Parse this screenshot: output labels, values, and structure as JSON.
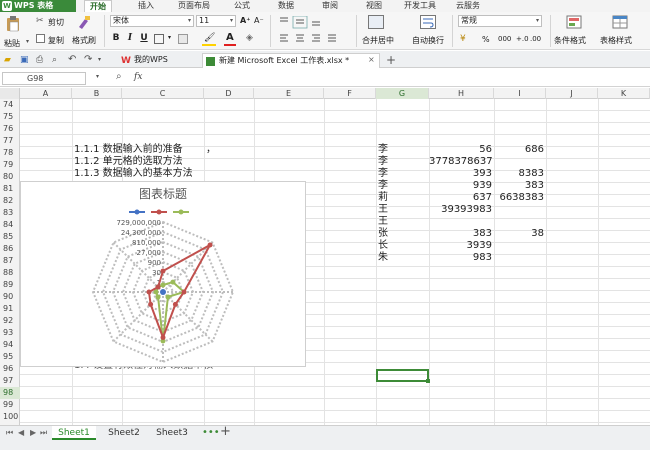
{
  "app": {
    "name": "WPS 表格",
    "logo": "wps-logo-icon"
  },
  "menu_tabs": [
    "开始",
    "插入",
    "页面布局",
    "公式",
    "数据",
    "审阅",
    "视图",
    "开发工具",
    "云服务"
  ],
  "active_menu_tab": "开始",
  "ribbon": {
    "paste": "粘贴",
    "cut": "剪切",
    "copy": "复制",
    "format_painter": "格式刷",
    "font_name": "宋体",
    "font_size": "11",
    "bold": "B",
    "italic": "I",
    "underline": "U",
    "merge_center": "合并居中",
    "wrap_text": "自动换行",
    "number_format": "常规",
    "percent": "%",
    "thousands": "000",
    "conditional_format": "条件格式",
    "table_style": "表格样式"
  },
  "doc_tabs": [
    {
      "label": "我的WPS",
      "icon": "wps-home-icon"
    },
    {
      "label": "新建 Microsoft Excel 工作表.xlsx *",
      "icon": "spreadsheet-icon"
    }
  ],
  "formula_bar": {
    "name_box": "G98",
    "fx": "fx",
    "zoom_icon": "magnifier-icon"
  },
  "columns": [
    "A",
    "B",
    "C",
    "D",
    "E",
    "F",
    "G",
    "H",
    "I",
    "J",
    "K"
  ],
  "selected_column": "G",
  "rows": [
    "74",
    "75",
    "76",
    "77",
    "78",
    "79",
    "80",
    "81",
    "82",
    "83",
    "84",
    "85",
    "86",
    "87",
    "88",
    "89",
    "90",
    "91",
    "92",
    "93",
    "94",
    "95",
    "96",
    "97",
    "98",
    "99",
    "100",
    "101",
    "102",
    "103"
  ],
  "selected_row": "98",
  "cells": {
    "b78": "1.1.1 数据输入前的准备",
    "d78": "，",
    "b79": "1.1.2 单元格的选取方法",
    "b80": "1.1.3 数据输入的基本方法",
    "b97": "1.4 设置有效性对输入数据审核",
    "g78": "李",
    "h78": "56",
    "i78": "686",
    "g79": "李",
    "h79": "3778378637",
    "g80": "李",
    "h80": "393",
    "i80": "8383",
    "g81": "李",
    "h81": "939",
    "i81": "383",
    "g82": "莉",
    "h82": "637",
    "i82": "6638383",
    "g83": "王",
    "h83": "39393983",
    "g84": "王",
    "g85": "张",
    "h85": "383",
    "i85": "38",
    "g86": "长",
    "h86": "3939",
    "g87": "朱",
    "h87": "983"
  },
  "chart_data": {
    "type": "radar",
    "title": "图表标题",
    "axis_tick_labels": [
      "729,000,000",
      "24,300,000",
      "810,000",
      "27,000",
      "900",
      "30",
      "1"
    ],
    "scale": "log",
    "series": [
      {
        "color": "#4472c4"
      },
      {
        "color": "#c0504d"
      },
      {
        "color": "#9bbb59"
      }
    ],
    "legend_position": "top"
  },
  "sheets": [
    "Sheet1",
    "Sheet2",
    "Sheet3"
  ],
  "active_sheet": "Sheet1",
  "colors": {
    "accent": "#3d8b37",
    "selected_header": "#dbe8d5"
  }
}
